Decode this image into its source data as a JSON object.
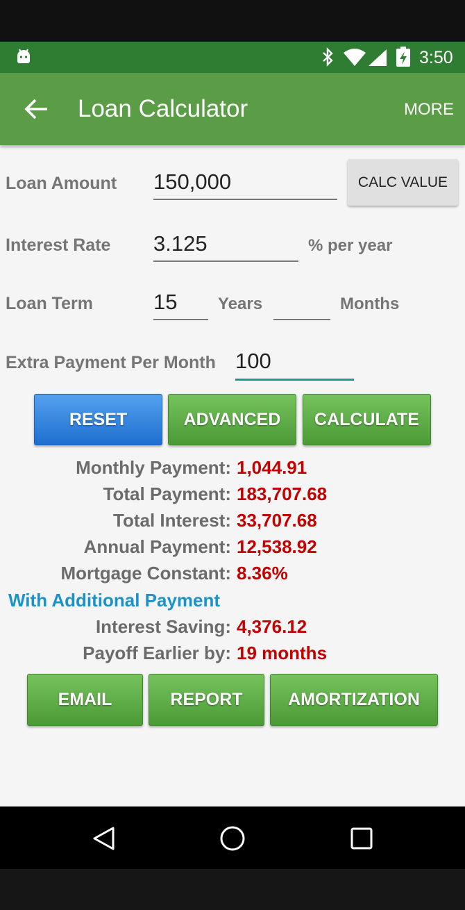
{
  "status_bar": {
    "time": "3:50",
    "icons": [
      "android-notification-icon",
      "bluetooth-icon",
      "wifi-icon",
      "cell-signal-icon",
      "battery-charging-icon"
    ]
  },
  "app_bar": {
    "title": "Loan Calculator",
    "more_label": "MORE",
    "back_icon": "arrow-left-icon",
    "color": "#5b9d47"
  },
  "form": {
    "loan_amount_label": "Loan Amount",
    "loan_amount_value": "150,000",
    "calc_value_label": "CALC VALUE",
    "interest_rate_label": "Interest Rate",
    "interest_rate_value": "3.125",
    "interest_unit": "% per year",
    "loan_term_label": "Loan Term",
    "loan_term_years_value": "15",
    "years_label": "Years",
    "loan_term_months_value": "",
    "months_label": "Months",
    "extra_payment_label": "Extra Payment Per Month",
    "extra_payment_value": "100"
  },
  "actions": {
    "reset_label": "RESET",
    "advanced_label": "ADVANCED",
    "calculate_label": "CALCULATE"
  },
  "results": [
    {
      "label": "Monthly Payment:",
      "value": "1,044.91"
    },
    {
      "label": "Total Payment:",
      "value": "183,707.68"
    },
    {
      "label": "Total Interest:",
      "value": "33,707.68"
    },
    {
      "label": "Annual Payment:",
      "value": "12,538.92"
    },
    {
      "label": "Mortgage Constant:",
      "value": "8.36%"
    }
  ],
  "additional": {
    "heading": "With Additional Payment",
    "rows": [
      {
        "label": "Interest Saving:",
        "value": "4,376.12"
      },
      {
        "label": "Payoff Earlier by:",
        "value": "19 months"
      }
    ]
  },
  "bottom_actions": {
    "email_label": "EMAIL",
    "report_label": "REPORT",
    "amortization_label": "AMORTIZATION"
  },
  "colors": {
    "status_bar": "#2f7d32",
    "result_value": "#c40000",
    "section_heading": "#1b93c9",
    "green_button": "#5aa843",
    "blue_button": "#2f82de"
  },
  "nav_bar": {
    "icons": [
      "back-triangle-icon",
      "home-circle-icon",
      "recents-square-icon"
    ]
  }
}
